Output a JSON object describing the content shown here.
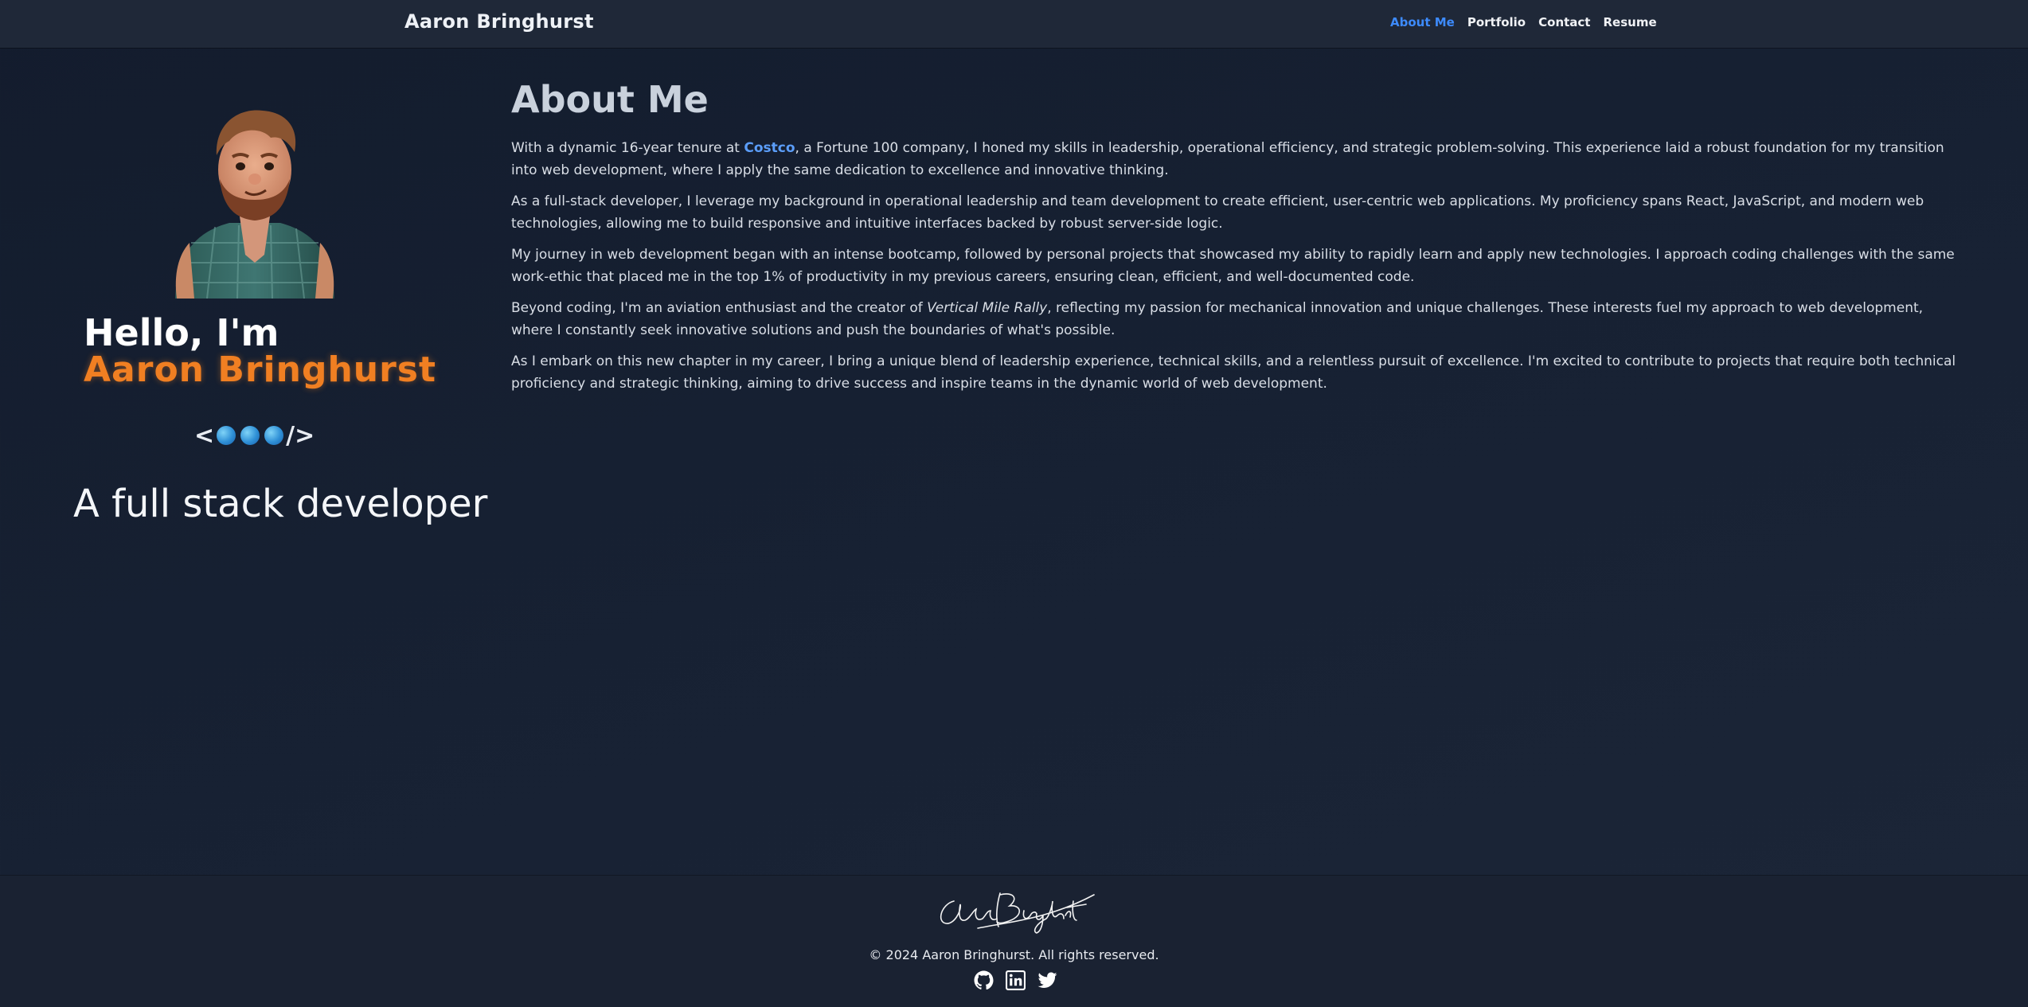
{
  "header": {
    "brand": "Aaron Bringhurst",
    "nav": [
      {
        "label": "About Me",
        "active": true
      },
      {
        "label": "Portfolio",
        "active": false
      },
      {
        "label": "Contact",
        "active": false
      },
      {
        "label": "Resume",
        "active": false
      }
    ]
  },
  "hero": {
    "greeting": "Hello, I'm",
    "name": "Aaron Bringhurst",
    "code_open": "<",
    "code_close": "/>",
    "tagline": "A full stack developer"
  },
  "about": {
    "title": "About Me",
    "p1_before": "With a dynamic 16-year tenure at ",
    "p1_link": "Costco",
    "p1_after": ", a Fortune 100 company, I honed my skills in leadership, operational efficiency, and strategic problem-solving. This experience laid a robust foundation for my transition into web development, where I apply the same dedication to excellence and innovative thinking.",
    "p2": "As a full-stack developer, I leverage my background in operational leadership and team development to create efficient, user-centric web applications. My proficiency spans React, JavaScript, and modern web technologies, allowing me to build responsive and intuitive interfaces backed by robust server-side logic.",
    "p3": "My journey in web development began with an intense bootcamp, followed by personal projects that showcased my ability to rapidly learn and apply new technologies. I approach coding challenges with the same work-ethic that placed me in the top 1% of productivity in my previous careers, ensuring clean, efficient, and well-documented code.",
    "p4_before": "Beyond coding, I'm an aviation enthusiast and the creator of ",
    "p4_em": "Vertical Mile Rally",
    "p4_after": ", reflecting my passion for mechanical innovation and unique challenges. These interests fuel my approach to web development, where I constantly seek innovative solutions and push the boundaries of what's possible.",
    "p5": "As I embark on this new chapter in my career, I bring a unique blend of leadership experience, technical skills, and a relentless pursuit of excellence. I'm excited to contribute to projects that require both technical proficiency and strategic thinking, aiming to drive success and inspire teams in the dynamic world of web development."
  },
  "footer": {
    "signature": "Aaron Bringhurst",
    "copyright": "© 2024 Aaron Bringhurst. All rights reserved.",
    "socials": [
      "github-icon",
      "linkedin-icon",
      "twitter-icon"
    ]
  },
  "colors": {
    "accent": "#3d8bfd",
    "name_orange": "#f07f22",
    "background": "#172133",
    "navbar": "#1f2838"
  }
}
